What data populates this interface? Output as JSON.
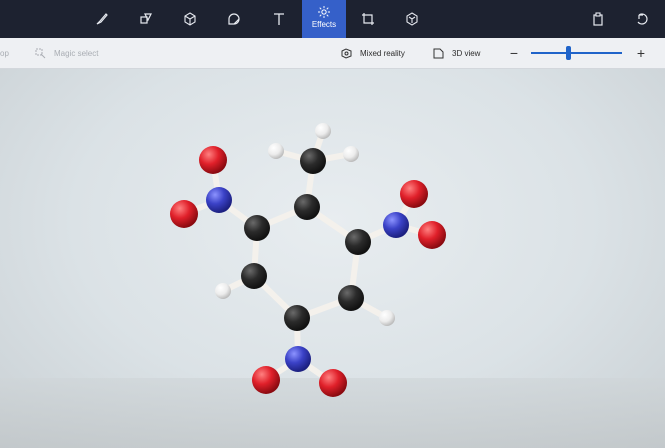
{
  "toolbar": {
    "tools": [
      {
        "name": "brushes-icon"
      },
      {
        "name": "2d-shapes-icon"
      },
      {
        "name": "3d-shapes-icon"
      },
      {
        "name": "stickers-icon"
      },
      {
        "name": "text-icon"
      },
      {
        "name": "effects-icon",
        "label": "Effects",
        "active": true
      },
      {
        "name": "canvas-icon"
      },
      {
        "name": "3d-library-icon"
      }
    ],
    "right": [
      "paste-icon",
      "undo-icon"
    ]
  },
  "subtoolbar": {
    "crop_label": "op",
    "magic_select_label": "Magic select",
    "mixed_reality_label": "Mixed reality",
    "view_3d_label": "3D view",
    "zoom_out": "−",
    "zoom_in": "+",
    "zoom_level": 0.4
  },
  "colors": {
    "toolbar_bg": "#1d2230",
    "active_tab": "#3560c9",
    "carbon": "#2b2b2b",
    "hydrogen": "#f2f2f2",
    "nitrogen": "#3b42c7",
    "oxygen": "#e0202a"
  }
}
